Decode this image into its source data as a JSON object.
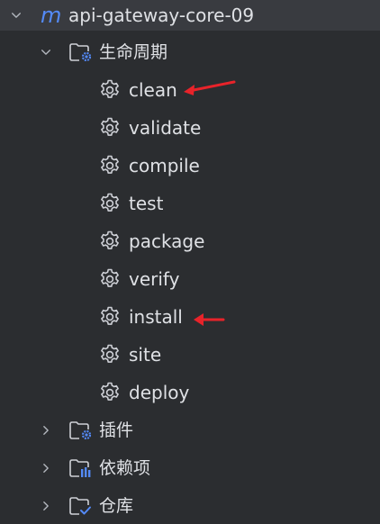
{
  "project": {
    "icon": "maven-m-icon",
    "name": "api-gateway-core-09"
  },
  "lifecycle": {
    "label": "生命周期",
    "icon": "folder-gear-icon",
    "goals": [
      "clean",
      "validate",
      "compile",
      "test",
      "package",
      "verify",
      "install",
      "site",
      "deploy"
    ],
    "goal_icon": "gear-icon"
  },
  "plugins": {
    "label": "插件",
    "icon": "folder-gear-icon"
  },
  "dependencies": {
    "label": "依赖项",
    "icon": "folder-library-icon"
  },
  "repositories": {
    "label": "仓库",
    "icon": "folder-check-icon"
  },
  "colors": {
    "background": "#2b2d30",
    "selected_row": "#393b40",
    "text": "#dfe1e5",
    "maven_blue": "#548af7",
    "annotation_arrow": "#e8232a"
  }
}
